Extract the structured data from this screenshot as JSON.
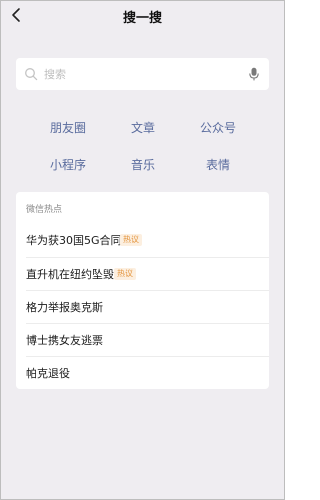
{
  "header": {
    "title": "搜一搜"
  },
  "search": {
    "placeholder": "搜索"
  },
  "categories": [
    {
      "label": "朋友圈"
    },
    {
      "label": "文章"
    },
    {
      "label": "公众号"
    },
    {
      "label": "小程序"
    },
    {
      "label": "音乐"
    },
    {
      "label": "表情"
    }
  ],
  "hot": {
    "header": "微信热点",
    "items": [
      {
        "text": "华为获30国5G合同",
        "tag": "热议"
      },
      {
        "text": "直升机在纽约坠毁",
        "tag": "热议"
      },
      {
        "text": "格力举报奥克斯"
      },
      {
        "text": "博士携女友逃票"
      },
      {
        "text": "帕克退役"
      }
    ]
  },
  "colors": {
    "background": "#efedf1",
    "category_text": "#596b9d",
    "tag_text": "#e3933b",
    "tag_bg": "#fcefe0"
  },
  "icons": [
    "back-chevron-icon",
    "search-icon",
    "microphone-icon"
  ]
}
